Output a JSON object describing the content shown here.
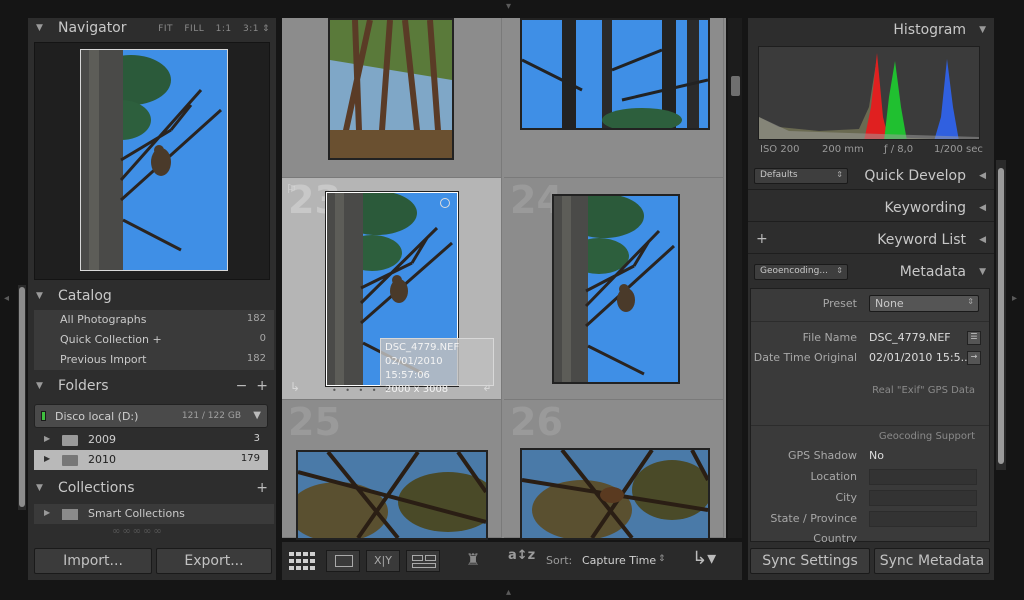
{
  "navigator": {
    "title": "Navigator",
    "zoom_options": [
      "FIT",
      "FILL",
      "1:1",
      "3:1"
    ]
  },
  "catalog": {
    "title": "Catalog",
    "items": [
      {
        "label": "All Photographs",
        "count": "182"
      },
      {
        "label": "Quick Collection +",
        "count": "0"
      },
      {
        "label": "Previous Import",
        "count": "182"
      }
    ]
  },
  "folders": {
    "title": "Folders",
    "disk_label": "Disco local (D:)",
    "disk_capacity": "121 / 122 GB",
    "items": [
      {
        "label": "2009",
        "count": "3"
      },
      {
        "label": "2010",
        "count": "179"
      }
    ]
  },
  "collections": {
    "title": "Collections",
    "items": [
      {
        "label": "Smart Collections"
      }
    ]
  },
  "buttons": {
    "import": "Import...",
    "export": "Export...",
    "sync_settings": "Sync Settings",
    "sync_metadata": "Sync Metadata"
  },
  "grid": {
    "cell_numbers": [
      "23",
      "24",
      "25",
      "26"
    ],
    "tooltip": {
      "filename": "DSC_4779.NEF",
      "datetime": "02/01/2010 15:57:06",
      "dimensions": "2000 x 3008"
    }
  },
  "toolbar": {
    "sort_label": "Sort:",
    "sort_value": "Capture Time"
  },
  "histogram": {
    "title": "Histogram",
    "iso": "ISO 200",
    "focal": "200 mm",
    "aperture": "ƒ / 8,0",
    "shutter": "1/200 sec"
  },
  "quick_develop": {
    "title": "Quick Develop",
    "preset_dropdown": "Defaults"
  },
  "keywording": {
    "title": "Keywording"
  },
  "keyword_list": {
    "title": "Keyword List"
  },
  "metadata": {
    "title": "Metadata",
    "view_dropdown": "Geoencoding...",
    "preset_label": "Preset",
    "preset_value": "None",
    "file_name_label": "File Name",
    "file_name_value": "DSC_4779.NEF",
    "date_label": "Date Time Original",
    "date_value": "02/01/2010 15:5...",
    "gps_note": "Real \"Exif\" GPS Data",
    "geo_support": "Geocoding Support",
    "gps_shadow_label": "GPS Shadow",
    "gps_shadow_value": "No",
    "location_label": "Location",
    "city_label": "City",
    "state_label": "State / Province",
    "country_label": "Country"
  },
  "colors": {
    "panel": "#2d2d2d",
    "grid": "#8c8c8c",
    "selected_cell": "#b5b5b5",
    "sky": "#3f8fe6",
    "disk_led": "#3fbf3f"
  }
}
